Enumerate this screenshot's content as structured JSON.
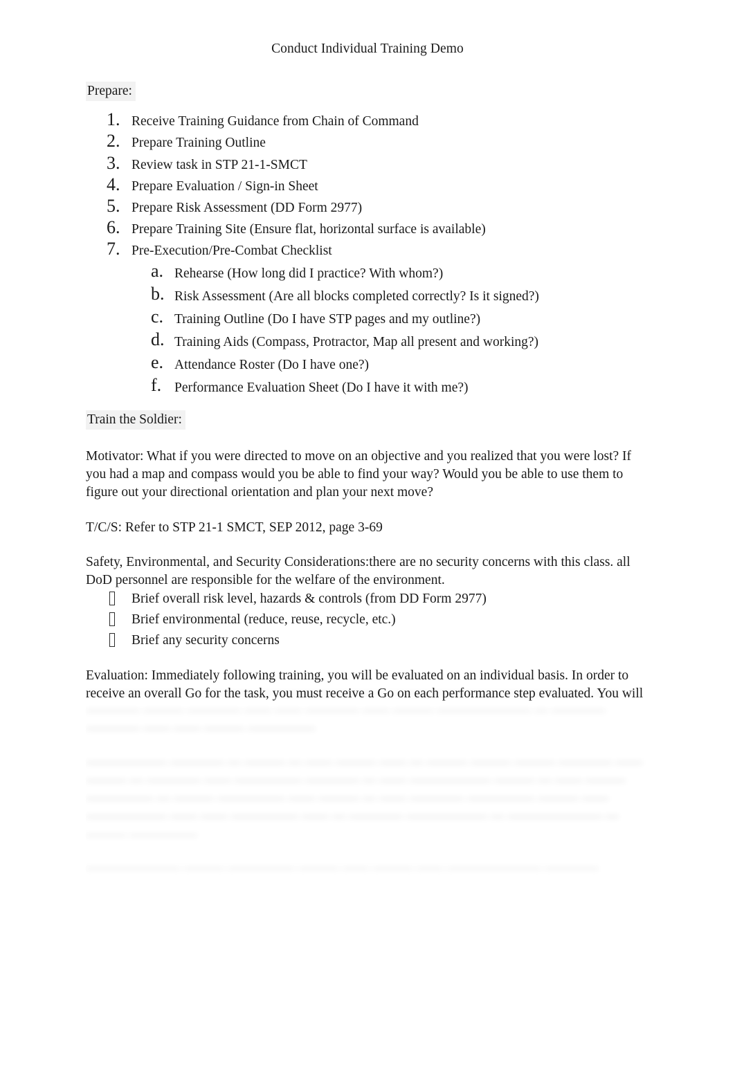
{
  "document": {
    "title": "Conduct Individual Training Demo",
    "sections": {
      "prepare_heading": "Prepare:",
      "train_heading": "Train  the Soldier:"
    },
    "prepare_steps": [
      {
        "marker": "1.",
        "text": "Receive Training Guidance from Chain of Command"
      },
      {
        "marker": "2.",
        "text": "Prepare Training Outline"
      },
      {
        "marker": "3.",
        "text": "Review task in STP 21-1-SMCT"
      },
      {
        "marker": "4.",
        "text": "Prepare Evaluation / Sign-in Sheet"
      },
      {
        "marker": "5.",
        "text": "Prepare Risk Assessment (DD Form 2977)"
      },
      {
        "marker": "6.",
        "text": "Prepare Training Site (Ensure flat, horizontal surface is available)"
      },
      {
        "marker": "7.",
        "text": "Pre-Execution/Pre-Combat Checklist"
      }
    ],
    "checklist_items": [
      {
        "marker": "a.",
        "text": "Rehearse (How long did I practice? With whom?)"
      },
      {
        "marker": "b.",
        "text": "Risk Assessment (Are all blocks completed correctly? Is it signed?)"
      },
      {
        "marker": "c.",
        "text": "Training Outline (Do I have STP pages and my outline?)"
      },
      {
        "marker": "d.",
        "text": "Training Aids (Compass, Protractor, Map all present and working?)"
      },
      {
        "marker": "e.",
        "text": "Attendance Roster (Do I have one?)"
      },
      {
        "marker": "f.",
        "text": "Performance Evaluation Sheet (Do I have it with me?)"
      }
    ],
    "motivator": "Motivator:   What if you were directed to move on an objective and you realized that you were lost? If you had a map and compass would you be able to find your way? Would you be able to use them to figure out your directional orientation and plan your next move?",
    "tcs": "T/C/S:  Refer to STP 21-1 SMCT, SEP 2012, page 3-69",
    "safety_intro": "Safety, Environmental, and Security Considerations:there are no security concerns with this class. all DoD personnel are responsible for the welfare of the environment.",
    "safety_bullets": [
      {
        "bullet": "wingding-box-bullet",
        "text": "Brief overall risk level, hazards & controls (from DD Form 2977)"
      },
      {
        "bullet": "wingding-box-bullet",
        "text": "Brief environmental (reduce, reuse, recycle, etc.)"
      },
      {
        "bullet": "wingding-box-bullet",
        "text": "Brief any security concerns"
      }
    ],
    "evaluation_visible": "Evaluation:   Immediately following training, you will be evaluated on an individual basis. In order to receive an overall Go for the task, you must receive a Go on each performance step evaluated. You will",
    "obscured_preview": {
      "note": "blurred-unreadable-preview-text",
      "block_1": "— ——— — — —— — —— — ———— ——— — ——— —— —— —— — — —— —— ———— ——— ———— —— —— ———— —— ——— ——————— — ———— ———— —— —— ——— —————",
      "block_2": "—————— ————     — ——— — —— ——— —— — ——— ——— ——— ———— —— ——— — ———— —— ————— ———— — —— —————— ——— — —— ——— ————— — ——— ————— —— ——— — —— ———— ————— ——— —— —————— —— —— ————— —— — ———— —————— — ——————— — ——— —————",
      "block_3": "——————— ——— —————     ——— —— ——— —— ——————— ————"
    }
  }
}
